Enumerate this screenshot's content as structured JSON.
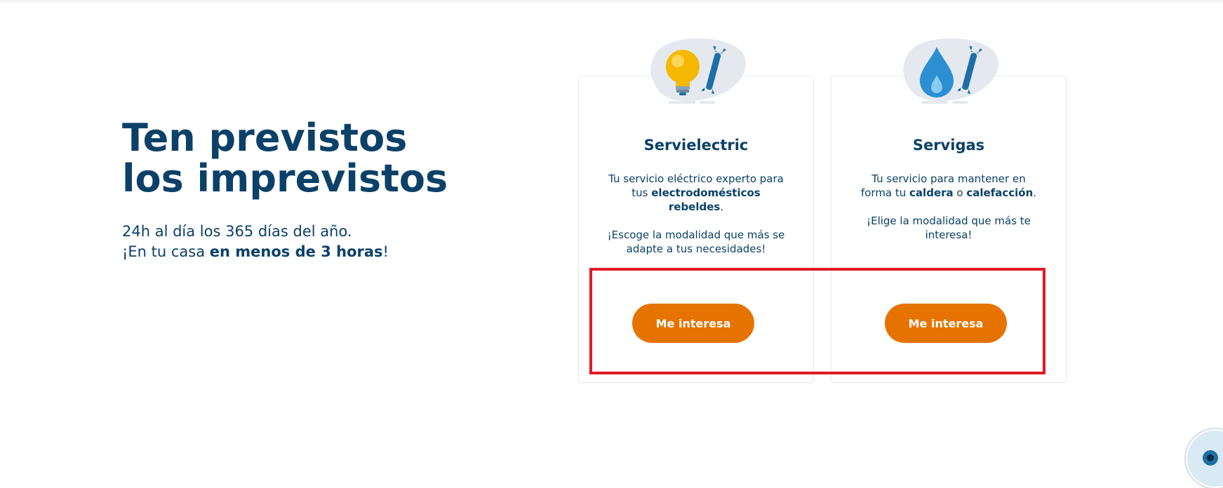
{
  "hero": {
    "title_line1": "Ten previstos",
    "title_line2": "los imprevistos",
    "sub_line1": "24h al día los 365 días del año.",
    "sub_line2_pre": "¡En tu casa ",
    "sub_line2_bold": "en menos de 3 horas",
    "sub_line2_post": "!"
  },
  "cards": [
    {
      "icon": "lightbulb-wrench-icon",
      "title": "Servielectric",
      "desc1_a": "Tu servicio eléctrico experto para tus ",
      "desc1_b": "electrodomésticos rebeldes",
      "desc1_c": ".",
      "desc2": "¡Escoge la modalidad que más se adapte a tus necesidades!",
      "button": "Me interesa"
    },
    {
      "icon": "gas-drop-wrench-icon",
      "title": "Servigas",
      "desc1_a": "Tu servicio para mantener en forma tu ",
      "desc1_b": "caldera",
      "desc1_c": " o ",
      "desc1_d": "calefacción",
      "desc1_e": ".",
      "desc2": "¡Elige la modalidad que más te interesa!",
      "button": "Me interesa"
    }
  ],
  "colors": {
    "brand_navy": "#0b4168",
    "button_orange": "#e67300",
    "highlight_red": "#e01b24",
    "icon_blue": "#1d6fa5",
    "bulb_yellow": "#f5b800"
  }
}
